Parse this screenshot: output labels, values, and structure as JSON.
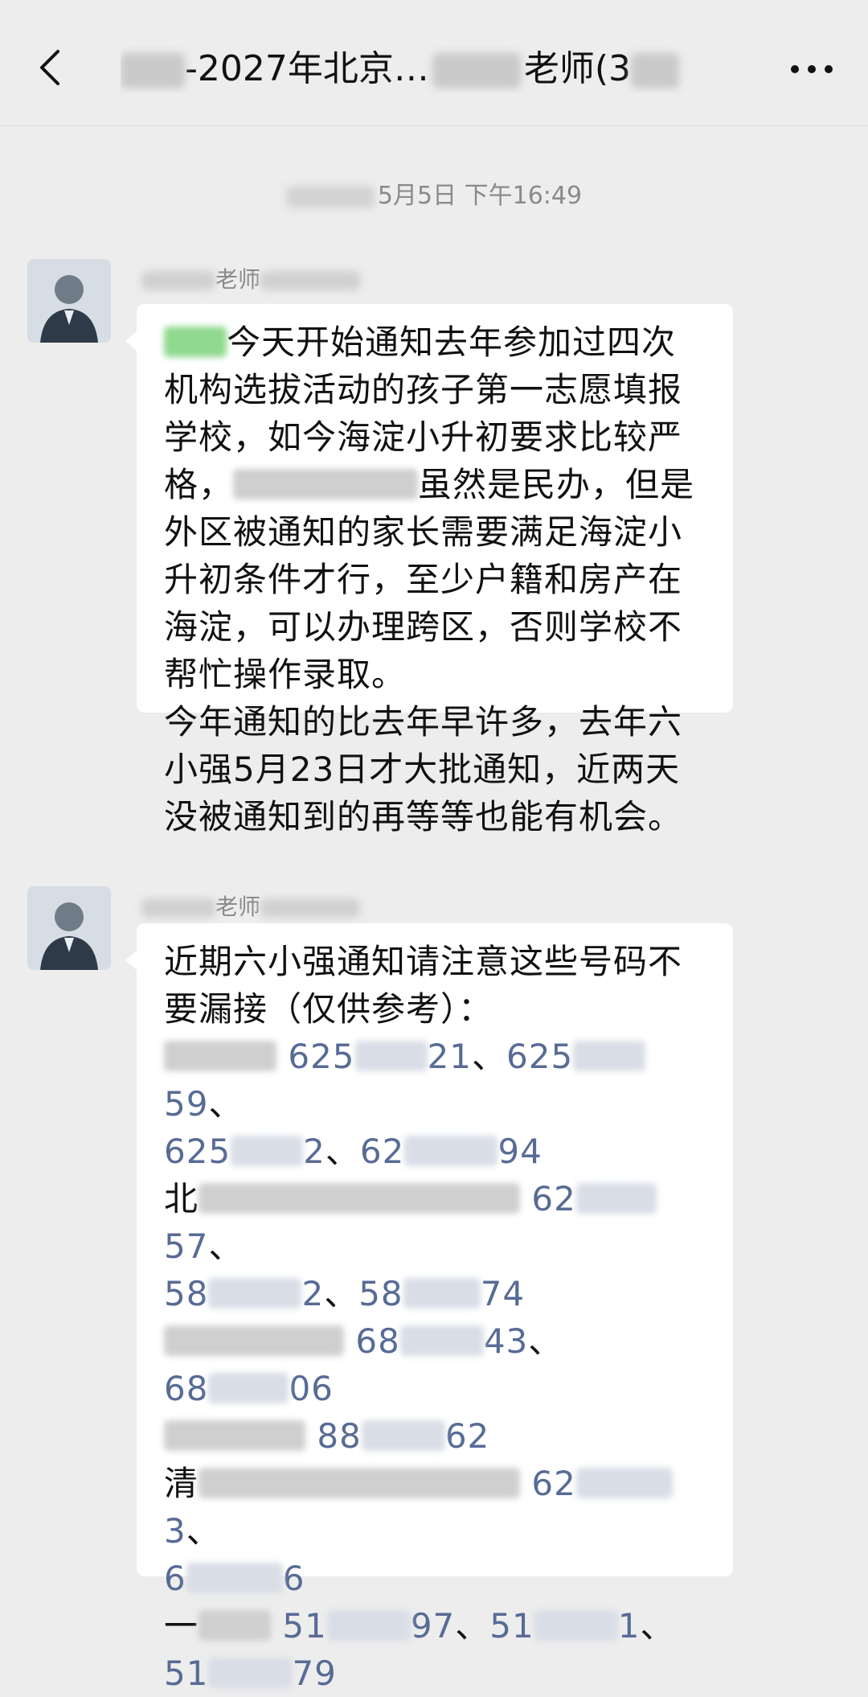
{
  "nav": {
    "title_pre": "-2027年北京…",
    "title_post": "老师(3"
  },
  "timestamp": "5月5日 下午16:49",
  "messages": [
    {
      "sender_label": "老师",
      "text_1": "今天开始通知去年参加过四次机构选拔活动的孩子第一志愿填报学校，如今海淀小升初要求比较严格，",
      "text_2": "虽然是民办，但是外区被通知的家长需要满足海淀小升初条件才行，至少户籍和房产在海淀，可以办理跨区，否则学校不帮忙操作录取。",
      "text_3": "今年通知的比去年早许多，去年六小强5月23日才大批通知，近两天没被通知到的再等等也能有机会。"
    },
    {
      "sender_label": "老师",
      "intro": "近期六小强通知请注意这些号码不要漏接（仅供参考）：",
      "line1": {
        "p1a": "625",
        "p1b": "21",
        "sep1": "、",
        "p2a": "625",
        "p2b": "59",
        "sep2": "、"
      },
      "line2": {
        "p1a": "625",
        "p1b": "2",
        "sep1": "、",
        "p2a": "62",
        "p2b": "94"
      },
      "line3": {
        "prefix": "北",
        "p1a": "62",
        "p1b": "57",
        "sep1": "、"
      },
      "line4": {
        "p1a": "58",
        "p1b": "2",
        "sep1": "、",
        "p2a": "58",
        "p2b": "74"
      },
      "line5": {
        "p1a": "68",
        "p1b": "43",
        "sep1": "、"
      },
      "line6": {
        "p1a": "68",
        "p1b": "06"
      },
      "line7": {
        "p1a": "88",
        "p1b": "62"
      },
      "line8": {
        "prefix": "清",
        "p1a": "62",
        "p1b": "3",
        "sep1": "、"
      },
      "line9": {
        "p1a": "6",
        "p1b": "6"
      },
      "line10": {
        "prefix": "一",
        "p1a": "51",
        "p1b": "97",
        "sep1": "、",
        "p2a": "51",
        "p2b": "1",
        "sep2": "、"
      },
      "line11": {
        "p1a": "51",
        "p1b": "79"
      }
    }
  ],
  "icons": {
    "back": "chevron-left-icon",
    "more": "more-dots-icon",
    "avatar": "avatar"
  }
}
